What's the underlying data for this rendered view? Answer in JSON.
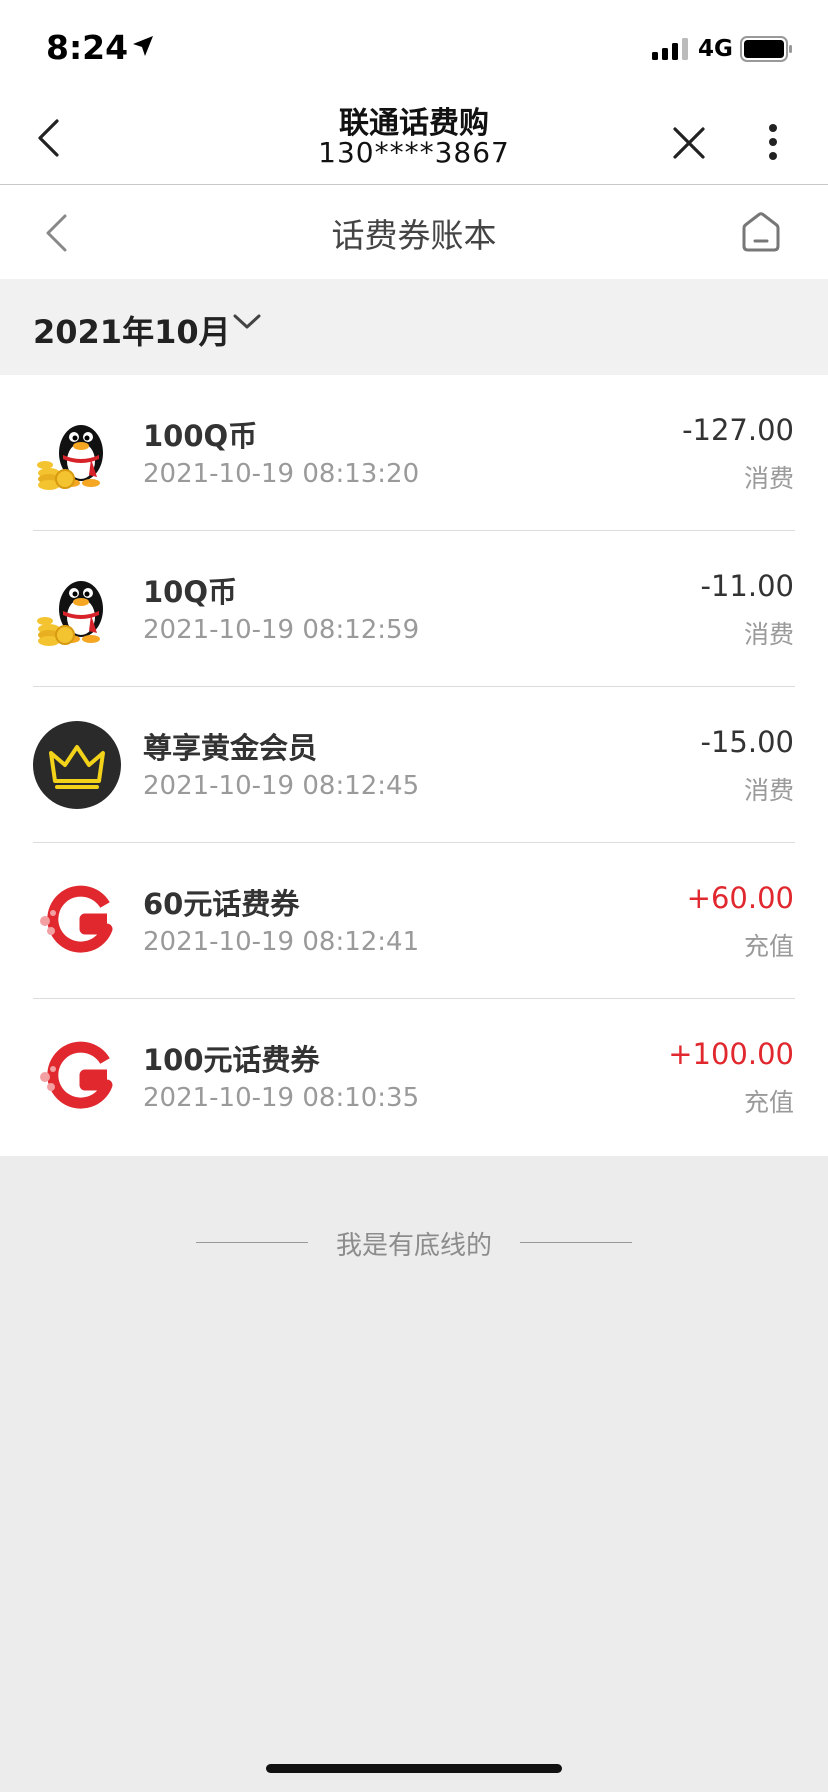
{
  "status": {
    "time": "8:24",
    "network": "4G"
  },
  "wechat": {
    "title": "联通话费购",
    "subtitle": "130****3867"
  },
  "page": {
    "title": "话费券账本"
  },
  "filter": {
    "month": "2021年10月"
  },
  "transactions": [
    {
      "name": "100Q币",
      "date": "2021-10-19 08:13:20",
      "amount": "-127.00",
      "kind": "消费",
      "icon": "qq-penguin-icon"
    },
    {
      "name": "10Q币",
      "date": "2021-10-19 08:12:59",
      "amount": "-11.00",
      "kind": "消费",
      "icon": "qq-penguin-icon"
    },
    {
      "name": "尊享黄金会员",
      "date": "2021-10-19 08:12:45",
      "amount": "-15.00",
      "kind": "消费",
      "icon": "gold-crown-icon"
    },
    {
      "name": "60元话费券",
      "date": "2021-10-19 08:12:41",
      "amount": "+60.00",
      "kind": "充值",
      "icon": "unicom-g-logo-icon"
    },
    {
      "name": "100元话费券",
      "date": "2021-10-19 08:10:35",
      "amount": "+100.00",
      "kind": "充值",
      "icon": "unicom-g-logo-icon"
    }
  ],
  "footer": {
    "text": "我是有底线的"
  },
  "colors": {
    "positive": "#e0282e",
    "negative": "#333333"
  }
}
